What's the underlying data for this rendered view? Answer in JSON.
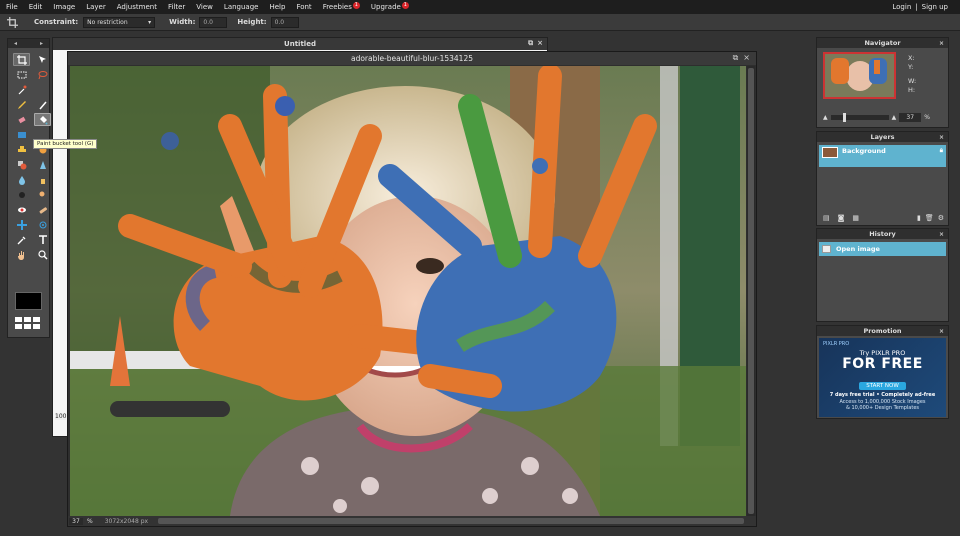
{
  "menu": {
    "items": [
      {
        "label": "File"
      },
      {
        "label": "Edit"
      },
      {
        "label": "Image"
      },
      {
        "label": "Layer"
      },
      {
        "label": "Adjustment"
      },
      {
        "label": "Filter"
      },
      {
        "label": "View"
      },
      {
        "label": "Language"
      },
      {
        "label": "Help"
      },
      {
        "label": "Font"
      },
      {
        "label": "Freebies",
        "badge": "1"
      },
      {
        "label": "Upgrade",
        "badge": "1"
      }
    ],
    "login": "Login",
    "separator": "|",
    "signup": "Sign up"
  },
  "options": {
    "constraint_label": "Constraint:",
    "constraint_value": "No restriction",
    "width_label": "Width:",
    "width_value": "0.0",
    "height_label": "Height:",
    "height_value": "0.0"
  },
  "tooltip": "Paint bucket tool (G)",
  "untitled_window": {
    "title": "Untitled",
    "zoom": "100"
  },
  "image_window": {
    "title": "adorable-beautiful-blur-1534125",
    "zoom": "37",
    "percent": "%",
    "dimensions": "3072x2048 px"
  },
  "navigator": {
    "title": "Navigator",
    "x_label": "X:",
    "y_label": "Y:",
    "w_label": "W:",
    "h_label": "H:",
    "zoom": "37",
    "percent": "%"
  },
  "layers": {
    "title": "Layers",
    "items": [
      {
        "name": "Background"
      }
    ]
  },
  "history": {
    "title": "History",
    "items": [
      {
        "label": "Open image"
      }
    ]
  },
  "promotion": {
    "title": "Promotion",
    "brand": "PIXLR PRO",
    "line1": "Try PIXLR PRO",
    "headline": "FOR FREE",
    "button": "START NOW",
    "line2": "7 days free trial • Completely ad-free",
    "line3": "Access to 1,000,000 Stock Images",
    "line4": "& 10,000+ Design Templates"
  },
  "close_glyph": "×",
  "colors": {
    "accent": "#5fb3cf",
    "menubar": "#1e1e1e",
    "panel": "#4a4a4a",
    "badge": "#d9262b"
  }
}
